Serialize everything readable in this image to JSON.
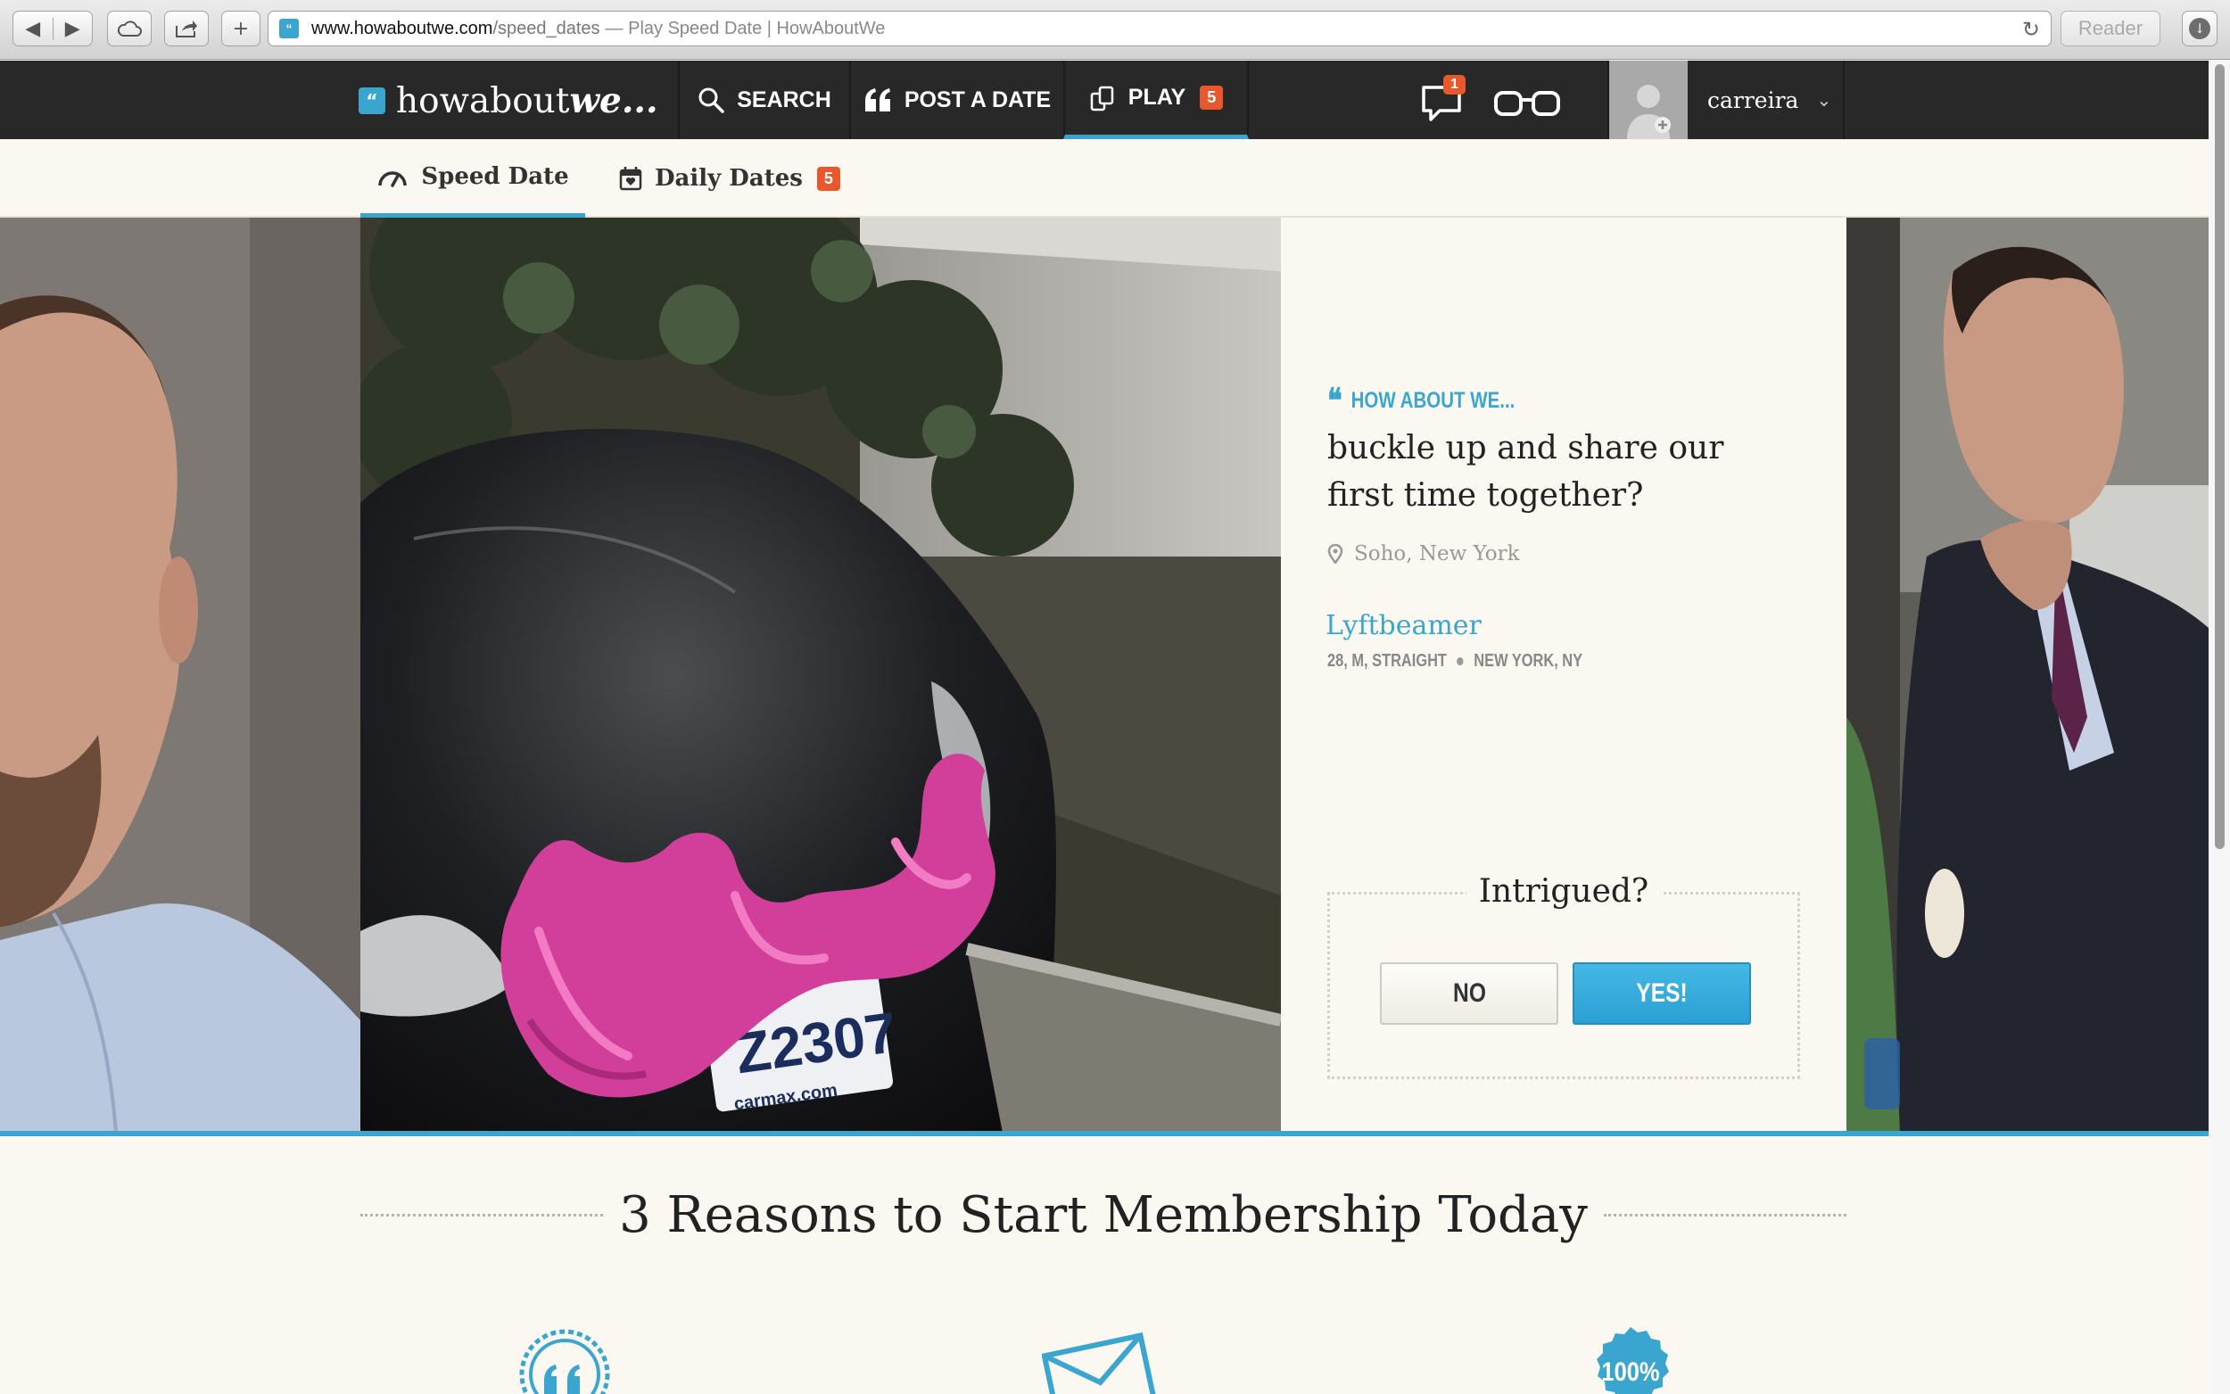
{
  "browser": {
    "url_host": "www.howaboutwe.com",
    "url_path": "/speed_dates",
    "page_title": "— Play Speed Date | HowAboutWe",
    "reader_label": "Reader"
  },
  "nav": {
    "logo_part1": "howabout",
    "logo_part2": "we...",
    "search_label": "SEARCH",
    "post_label": "POST A DATE",
    "play_label": "PLAY",
    "play_badge": "5",
    "messages_badge": "1",
    "username": "carreira"
  },
  "subnav": {
    "speed_date_label": "Speed Date",
    "daily_dates_label": "Daily Dates",
    "daily_dates_badge": "5"
  },
  "card": {
    "how_about_we_label": "HOW ABOUT WE...",
    "date_text": "buckle up and share our first time together?",
    "location": "Soho, New York",
    "profile_name": "Lyftbeamer",
    "profile_stats": "28, M, STRAIGHT",
    "profile_location": "NEW YORK, NY",
    "prompt": "Intrigued?",
    "no_label": "NO",
    "yes_label": "YES!"
  },
  "reasons": {
    "title": "3 Reasons to Start Membership Today",
    "badge_percent": "100%"
  },
  "colors": {
    "accent": "#3aa6d0",
    "badge": "#e8582c",
    "nav_bg": "#282828",
    "page_bg": "#faf8f0"
  }
}
